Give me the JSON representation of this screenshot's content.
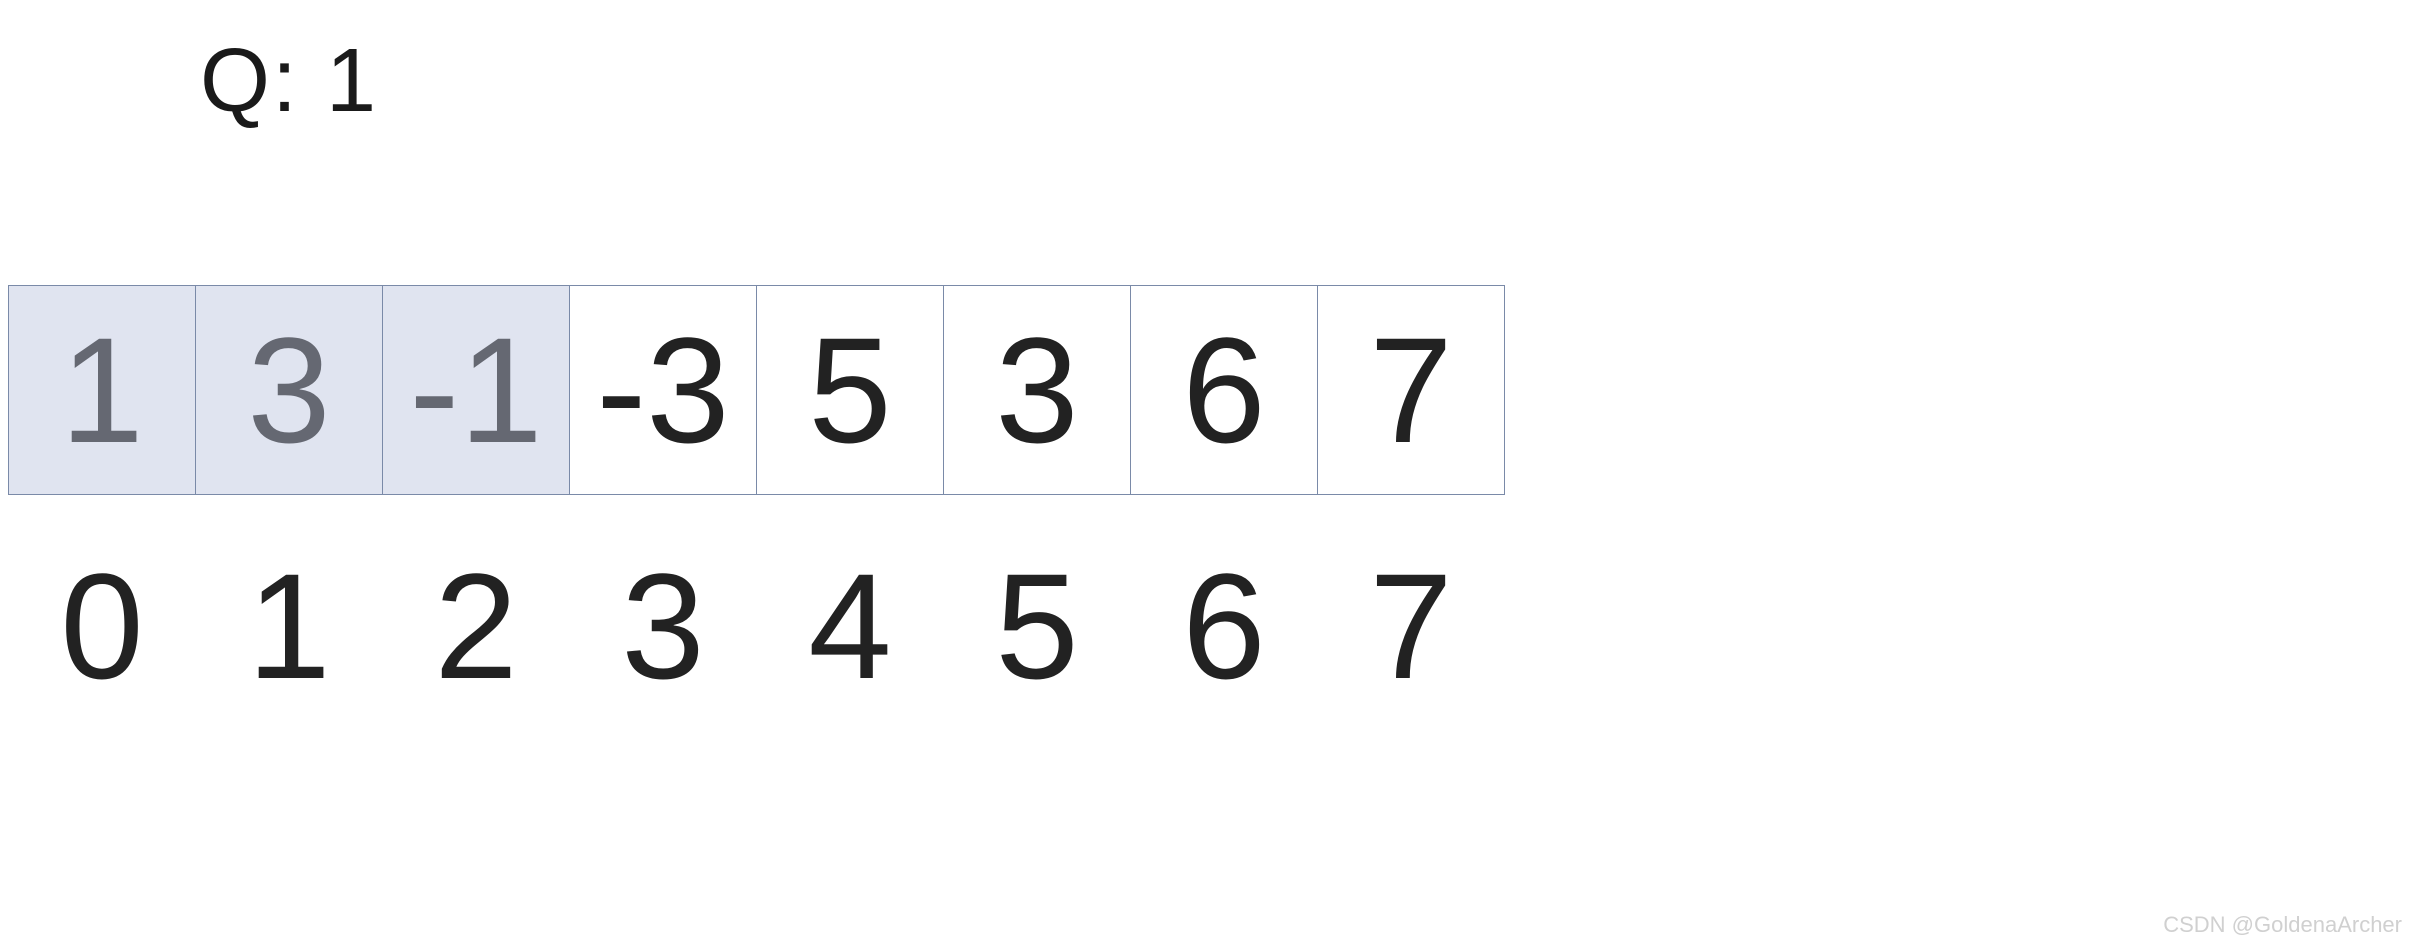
{
  "queue": {
    "label": "Q:",
    "value": "1"
  },
  "cells": [
    {
      "value": "1",
      "highlight": true
    },
    {
      "value": "3",
      "highlight": true
    },
    {
      "value": "-1",
      "highlight": true
    },
    {
      "value": "-3",
      "highlight": false
    },
    {
      "value": "5",
      "highlight": false
    },
    {
      "value": "3",
      "highlight": false
    },
    {
      "value": "6",
      "highlight": false
    },
    {
      "value": "7",
      "highlight": false
    }
  ],
  "indices": [
    "0",
    "1",
    "2",
    "3",
    "4",
    "5",
    "6",
    "7"
  ],
  "watermark": "CSDN @GoldenaArcher",
  "colors": {
    "highlight_bg": "#e0e4f0",
    "highlight_fg": "#656872",
    "cell_border": "#7a8aa8",
    "text": "#222222"
  }
}
